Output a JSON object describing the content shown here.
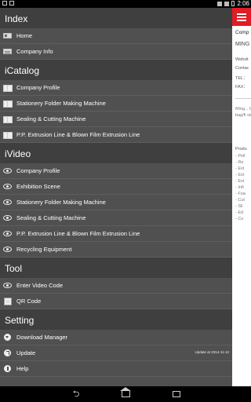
{
  "status_bar": {
    "time": "2:06"
  },
  "drawer": {
    "sections": [
      {
        "title": "Index",
        "items": [
          {
            "label": "Home",
            "icon": "home-icon"
          },
          {
            "label": "Company Info",
            "icon": "company-info-icon"
          }
        ]
      },
      {
        "title": "iCatalog",
        "items": [
          {
            "label": "Company Profile",
            "icon": "book-icon"
          },
          {
            "label": "Stationery Folder Making Machine",
            "icon": "book-icon"
          },
          {
            "label": "Sealing & Cutting Machine",
            "icon": "book-icon"
          },
          {
            "label": "P.P. Extrusion Line & Blown Film Extrusion Line",
            "icon": "book-icon"
          }
        ]
      },
      {
        "title": "iVideo",
        "items": [
          {
            "label": "Company Profile",
            "icon": "eye-icon"
          },
          {
            "label": "Exhibition Scene",
            "icon": "eye-icon"
          },
          {
            "label": "Stationery Folder Making Machine",
            "icon": "eye-icon"
          },
          {
            "label": "Sealing & Cutting Machine",
            "icon": "eye-icon"
          },
          {
            "label": "P.P. Extrusion Line & Blown Film Extrusion Line",
            "icon": "eye-icon"
          },
          {
            "label": "Recycling Equipment",
            "icon": "eye-icon"
          }
        ]
      },
      {
        "title": "Tool",
        "items": [
          {
            "label": "Enter Video Code",
            "icon": "eye-icon"
          },
          {
            "label": "QR Code",
            "icon": "qr-code-icon"
          }
        ]
      },
      {
        "title": "Setting",
        "items": [
          {
            "label": "Download Manager",
            "icon": "download-icon"
          },
          {
            "label": "Update",
            "icon": "update-icon",
            "meta": "Update at 2014-11-12"
          },
          {
            "label": "Help",
            "icon": "help-icon"
          }
        ]
      }
    ]
  },
  "main_panel": {
    "title": "Comp",
    "company": "MING",
    "fields": [
      "Websit",
      "Contac",
      "TEL：",
      "FAX："
    ],
    "description": "Ming... Our p waste bag/fi side s",
    "products_label": "Produ",
    "products": [
      "- Pell",
      "- Re",
      "- Ext",
      "- Ext",
      "- Ext",
      "- Infl",
      "- Foa",
      "- Cut",
      "- Sli",
      "- Ed",
      "- Co"
    ]
  },
  "colors": {
    "drawer_bg": "#505050",
    "header_bg": "#3f3f3f",
    "accent": "#e21b24"
  }
}
